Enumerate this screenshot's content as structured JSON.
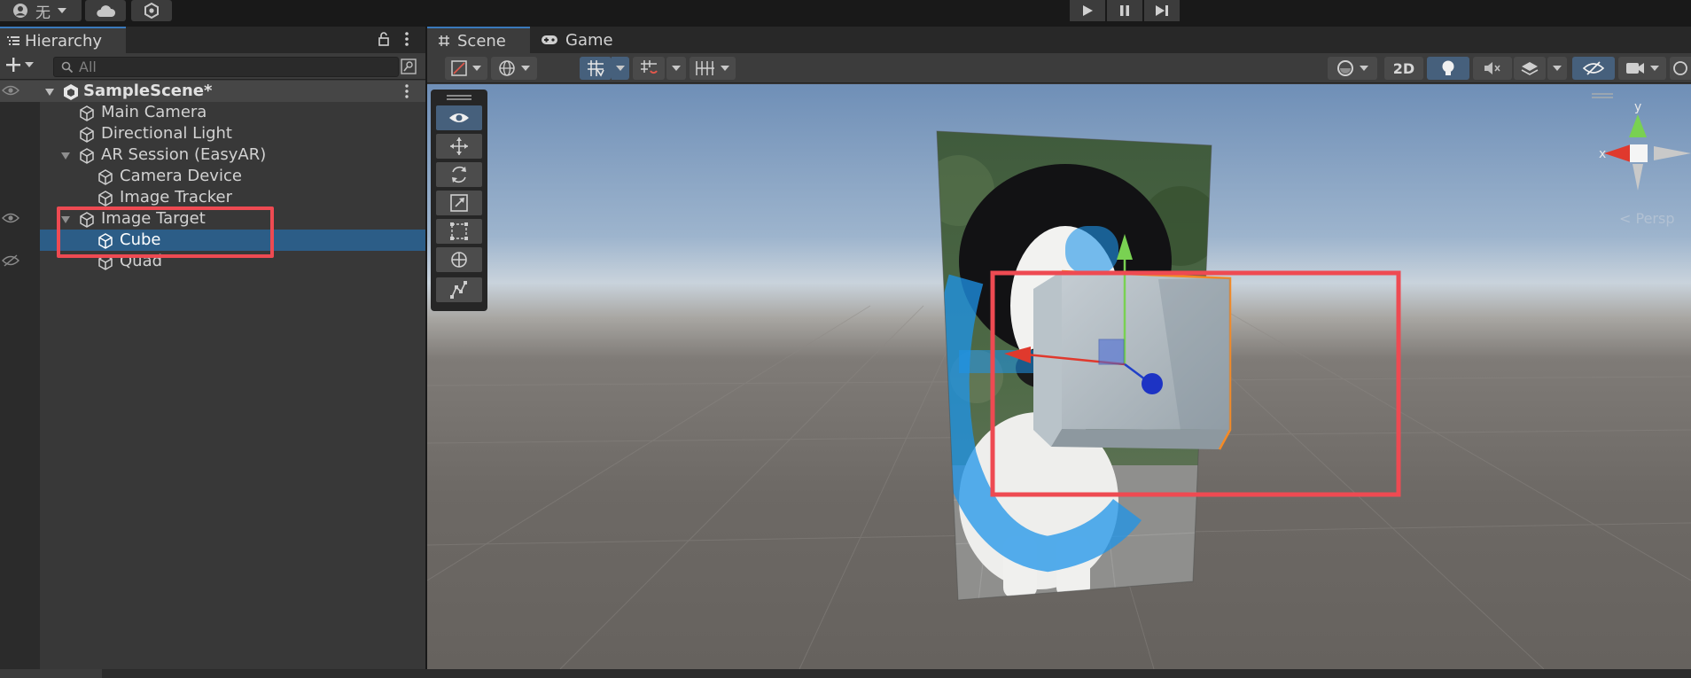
{
  "toolbar": {
    "account_label": "无",
    "icons": [
      "account-icon",
      "cloud-icon",
      "services-icon",
      "play-icon",
      "pause-icon",
      "step-icon"
    ]
  },
  "hierarchy": {
    "tab_label": "Hierarchy",
    "search_placeholder": "All",
    "items": [
      {
        "name": "SampleScene*",
        "type": "scene",
        "expanded": true
      },
      {
        "name": "Main Camera",
        "depth": 1
      },
      {
        "name": "Directional Light",
        "depth": 1
      },
      {
        "name": "AR Session (EasyAR)",
        "depth": 1,
        "expanded": true
      },
      {
        "name": "Camera Device",
        "depth": 2
      },
      {
        "name": "Image Tracker",
        "depth": 2
      },
      {
        "name": "Image Target",
        "depth": 1,
        "expanded": true
      },
      {
        "name": "Cube",
        "depth": 2,
        "selected": true
      },
      {
        "name": "Quad",
        "depth": 2,
        "hidden": true
      }
    ]
  },
  "scene_view": {
    "tabs": [
      {
        "label": "Scene",
        "icon": "hash-icon",
        "active": true
      },
      {
        "label": "Game",
        "icon": "gamepad-icon",
        "active": false
      }
    ],
    "mode_2d_label": "2D",
    "gizmo": {
      "x_label": "x",
      "y_label": "y"
    },
    "projection_label": "Persp"
  },
  "colors": {
    "highlight": "#ee4a52",
    "selection": "#2c5d87",
    "accent": "#3a79bb"
  }
}
